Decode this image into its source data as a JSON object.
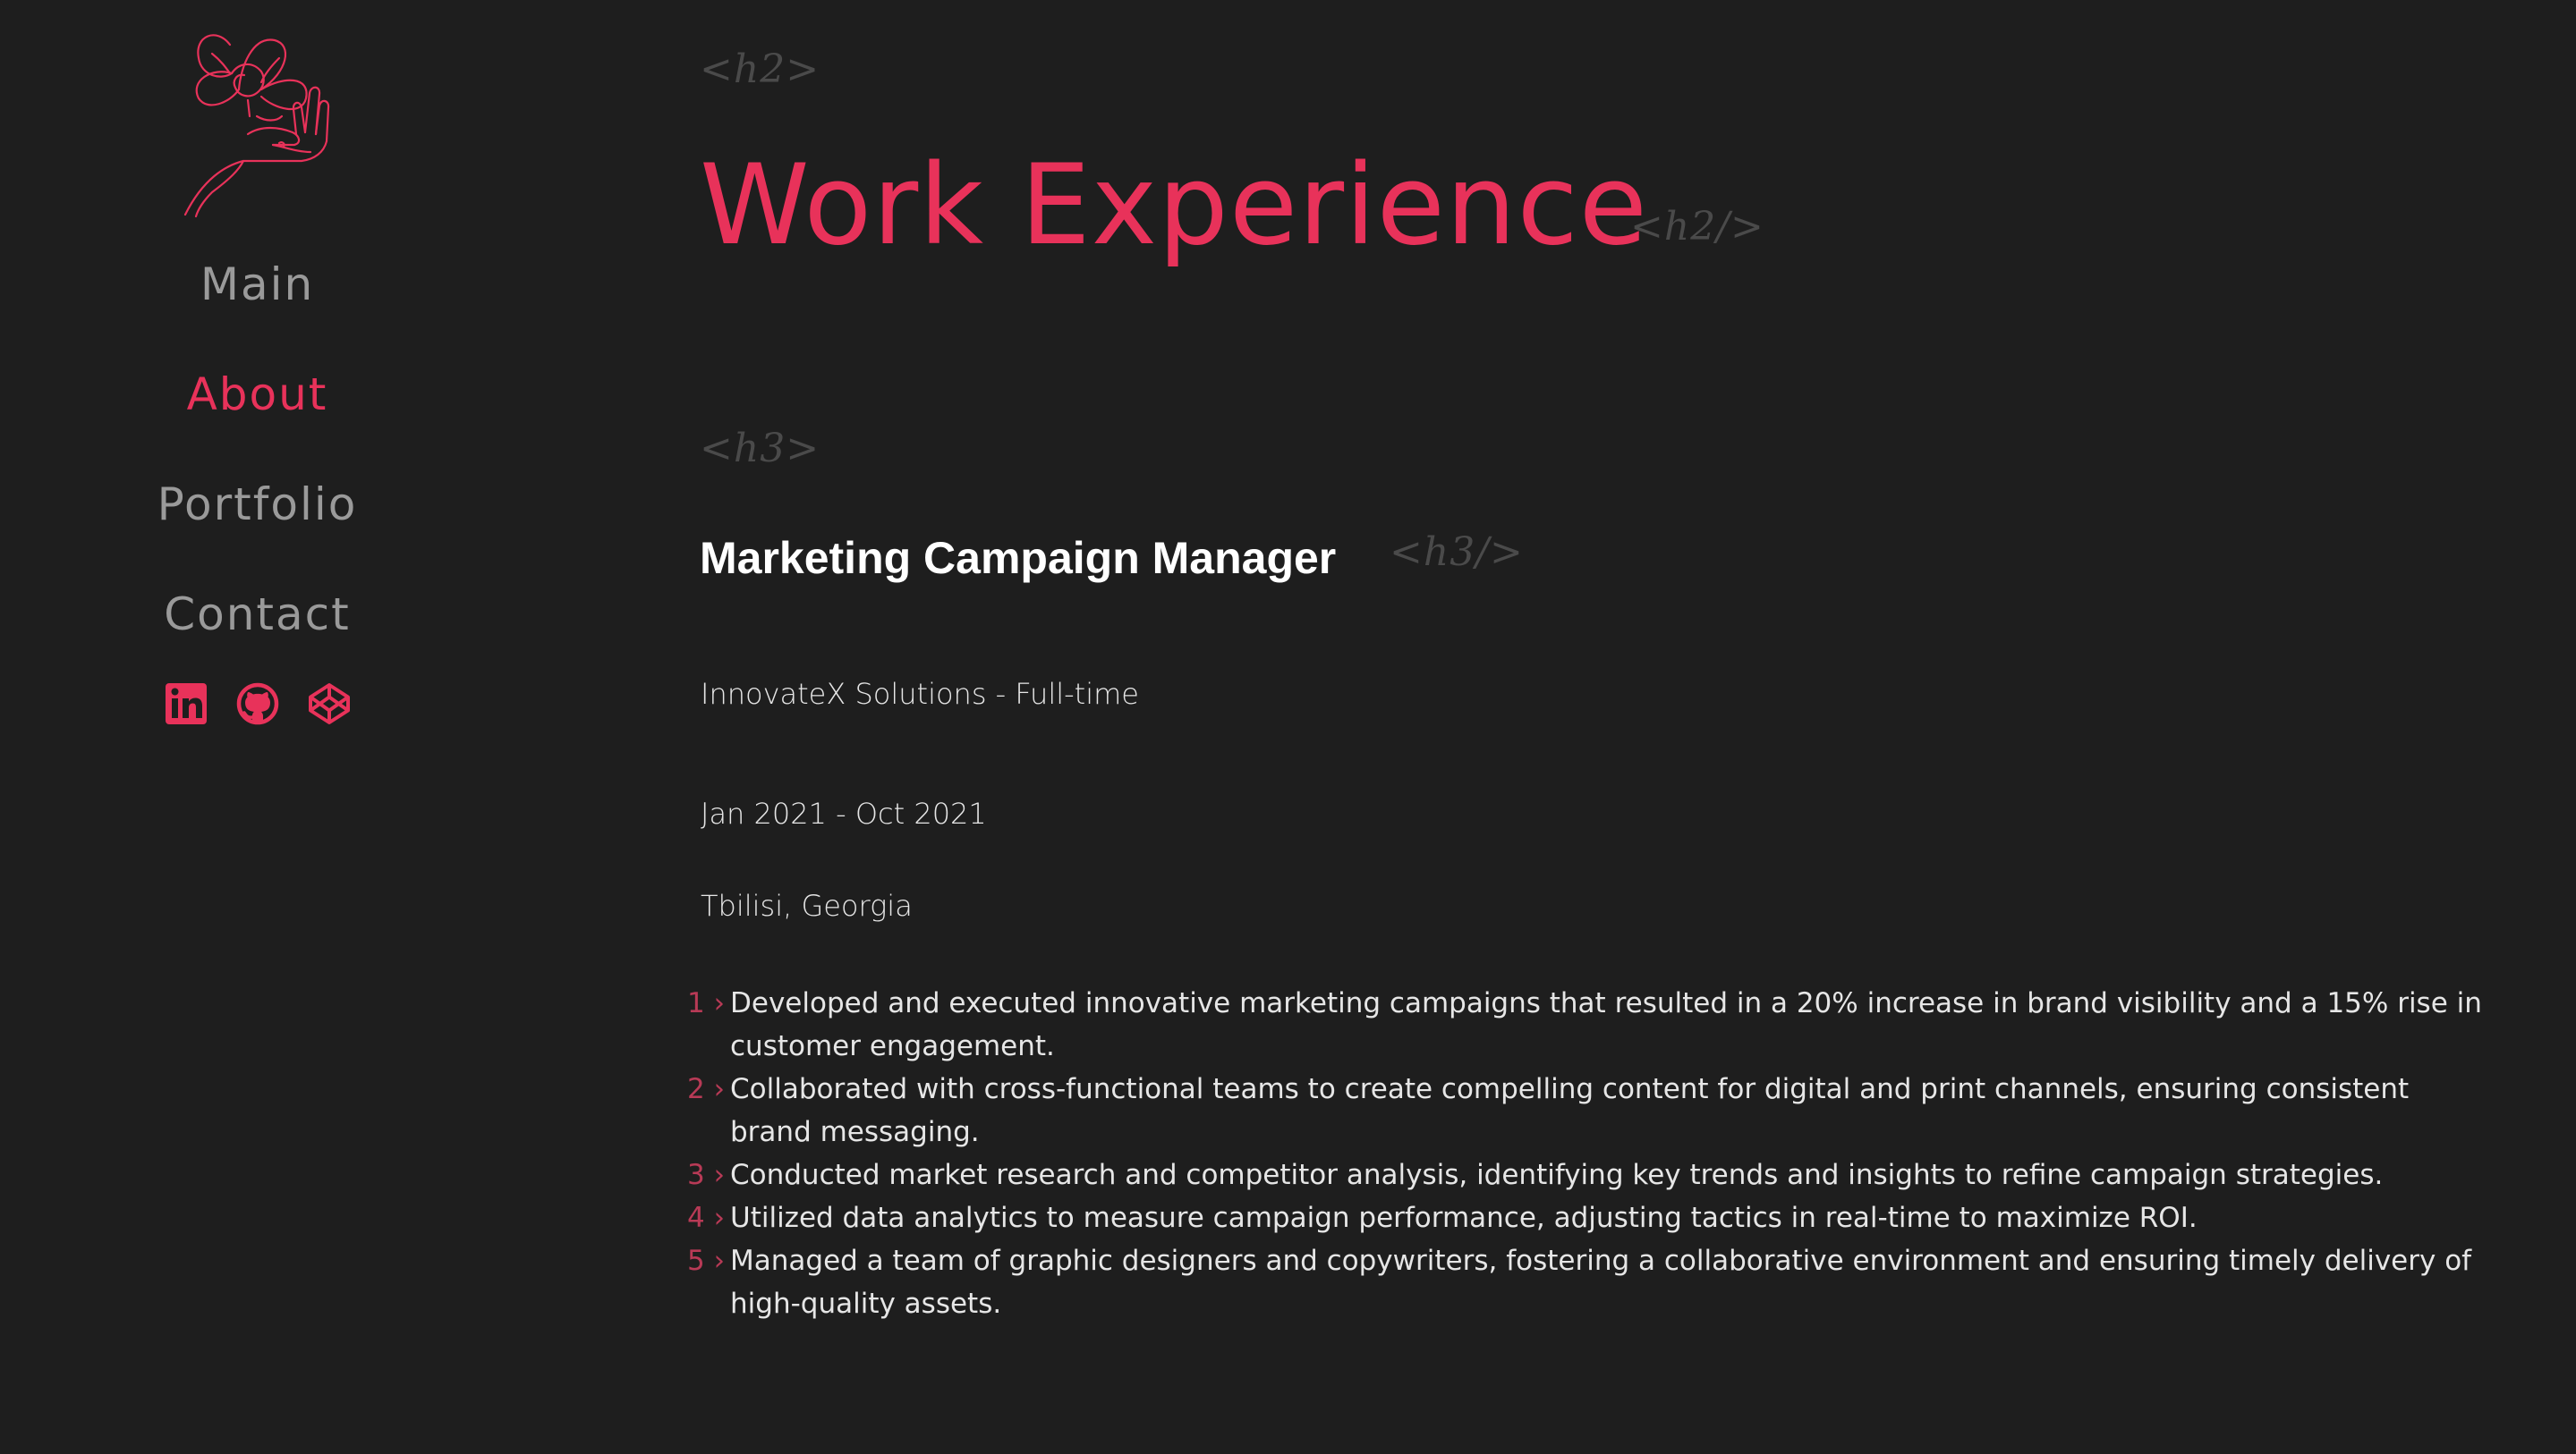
{
  "nav": {
    "items": [
      {
        "label": "Main"
      },
      {
        "label": "About"
      },
      {
        "label": "Portfolio"
      },
      {
        "label": "Contact"
      }
    ],
    "active": "About"
  },
  "socials": [
    {
      "icon": "linkedin-icon"
    },
    {
      "icon": "github-icon"
    },
    {
      "icon": "codepen-icon"
    }
  ],
  "colors": {
    "accent": "#e8325a",
    "background": "#1e1e1e",
    "muted_nav": "#9a9a9a",
    "tag": "#4a4a4a"
  },
  "section": {
    "tag_open": "<h2>",
    "title": "Work Experience",
    "tag_close": "<h2/>"
  },
  "job": {
    "tag_open": "<h3>",
    "title": "Marketing Campaign Manager",
    "tag_close": "<h3/>",
    "company": "InnovateX Solutions -  Full-time",
    "dates": "Jan 2021 - Oct 2021",
    "location": "Tbilisi, Georgia",
    "bullets": [
      {
        "num": "1 ›",
        "text": "Developed and executed innovative marketing campaigns that resulted in a 20% increase in brand visibility and a 15% rise in customer engagement."
      },
      {
        "num": "2 ›",
        "text": "Collaborated with cross-functional teams to create compelling content for digital and print channels, ensuring consistent brand messaging."
      },
      {
        "num": "3 ›",
        "text": "Conducted market research and competitor analysis, identifying key trends and insights to refine campaign strategies."
      },
      {
        "num": "4 ›",
        "text": "Utilized data analytics to measure campaign performance, adjusting tactics in real-time to maximize ROI."
      },
      {
        "num": "5 ›",
        "text": "Managed a team of graphic designers and copywriters, fostering a collaborative environment and ensuring timely delivery of high-quality assets."
      }
    ]
  }
}
